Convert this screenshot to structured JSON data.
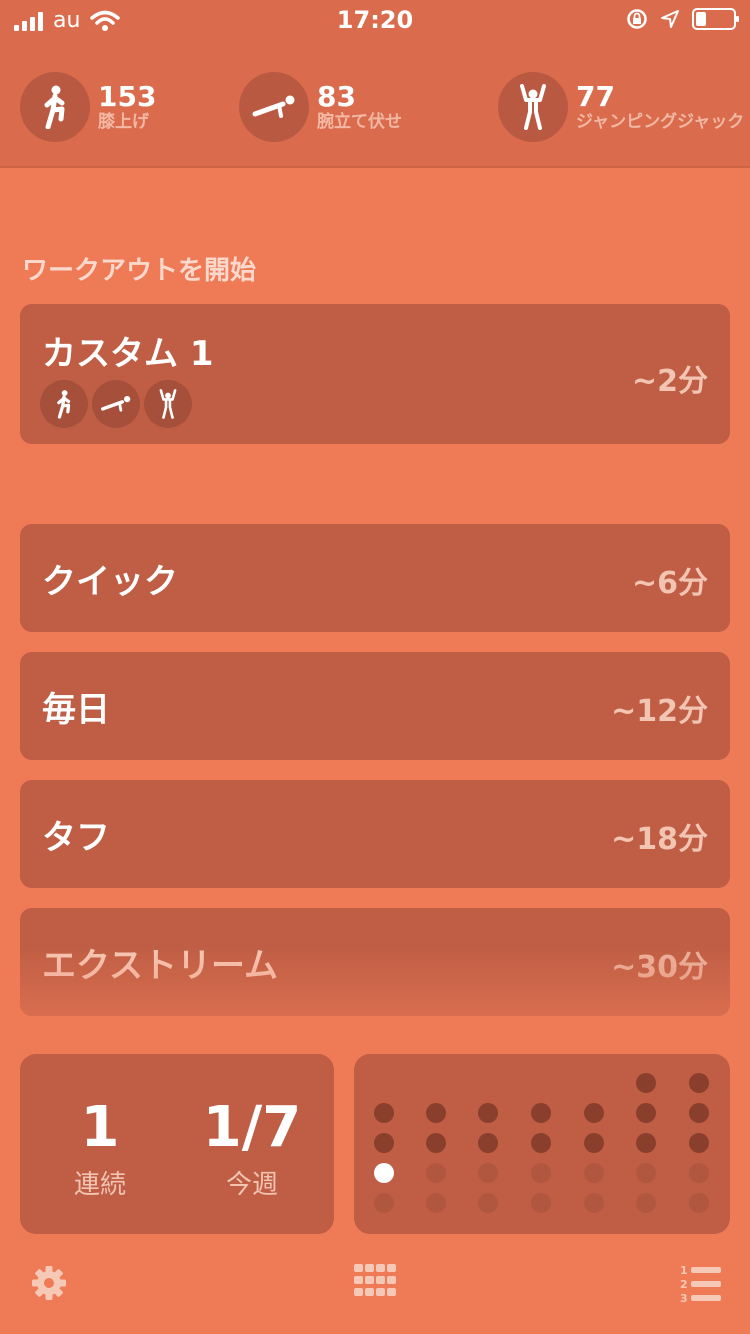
{
  "status_bar": {
    "carrier": "au",
    "time": "17:20"
  },
  "header_stats": [
    {
      "count": "153",
      "label": "膝上げ",
      "icon": "knee-raise-icon"
    },
    {
      "count": "83",
      "label": "腕立て伏せ",
      "icon": "push-up-icon"
    },
    {
      "count": "77",
      "label": "ジャンピングジャック",
      "icon": "jumping-jack-icon"
    }
  ],
  "section_title": "ワークアウトを開始",
  "custom_workout": {
    "name": "カスタム 1",
    "duration": "~2分",
    "exercise_icons": [
      "knee-raise-icon",
      "push-up-icon",
      "jumping-jack-icon"
    ]
  },
  "workouts": [
    {
      "name": "クイック",
      "duration": "~6分"
    },
    {
      "name": "毎日",
      "duration": "~12分"
    },
    {
      "name": "タフ",
      "duration": "~18分"
    },
    {
      "name": "エクストリーム",
      "duration": "~30分"
    }
  ],
  "streak": {
    "value": "1",
    "label": "連続"
  },
  "week": {
    "value": "1/7",
    "label": "今週"
  },
  "week_grid": {
    "completed_day_index": 0
  },
  "colors": {
    "background": "#EE7A56",
    "card": "#BF5E45",
    "header": "#DA6C4D"
  },
  "toolbar_icons": [
    "gear-icon",
    "grid-icon",
    "numbered-list-icon"
  ]
}
